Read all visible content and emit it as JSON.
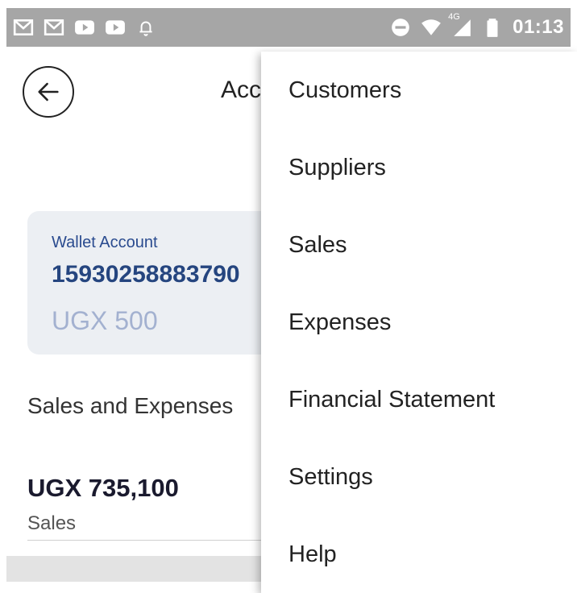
{
  "status_bar": {
    "time": "01:13",
    "left_icons": [
      "gmail-icon",
      "gmail-icon",
      "youtube-icon",
      "youtube-icon",
      "bell-icon"
    ],
    "network": "4G",
    "right_icons": [
      "do-not-disturb-icon",
      "wifi-icon",
      "cellular-signal-icon",
      "battery-icon"
    ]
  },
  "header": {
    "back_icon": "arrow-left-icon",
    "title": "Acc"
  },
  "wallet": {
    "label": "Wallet Account",
    "account_number": "15930258883790",
    "balance": "UGX 500"
  },
  "sales_expenses": {
    "heading": "Sales and Expenses",
    "amount": "UGX 735,100",
    "amount_label": "Sales"
  },
  "menu": {
    "items": [
      {
        "label": "Customers"
      },
      {
        "label": "Suppliers"
      },
      {
        "label": "Sales"
      },
      {
        "label": "Expenses"
      },
      {
        "label": "Financial Statement"
      },
      {
        "label": "Settings"
      },
      {
        "label": "Help"
      }
    ]
  },
  "colors": {
    "status_bar": "#a6a6a6",
    "wallet_card": "#eceff3",
    "wallet_number": "#25457f",
    "wallet_balance": "#a3b1d0"
  }
}
